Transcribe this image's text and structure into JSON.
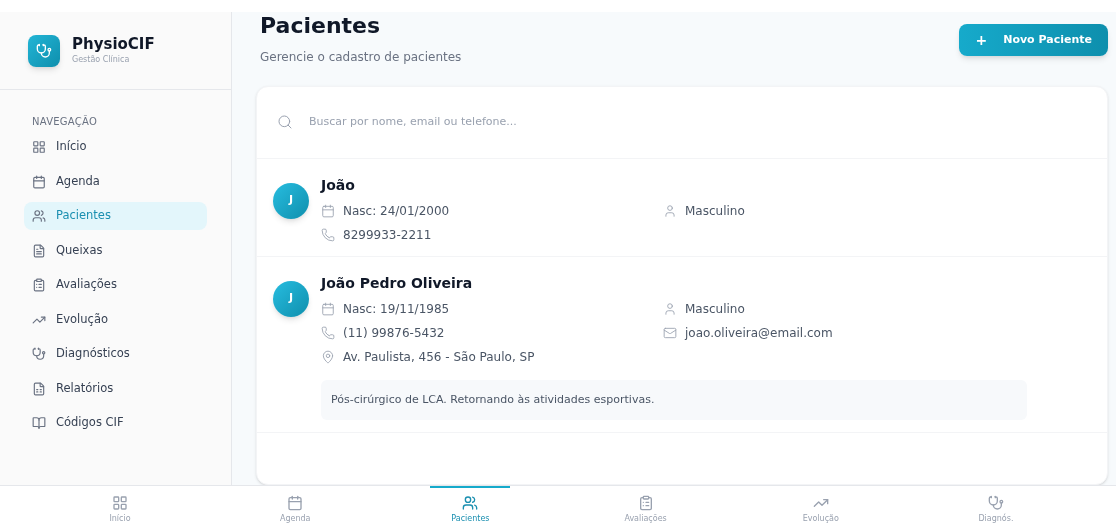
{
  "brand": {
    "name": "PhysioCIF",
    "tagline": "Gestão Clínica"
  },
  "sidebar": {
    "heading": "NAVEGAÇÃO",
    "items": [
      {
        "label": "Início",
        "kind": "grid",
        "selected": false
      },
      {
        "label": "Agenda",
        "kind": "calendar",
        "selected": false
      },
      {
        "label": "Pacientes",
        "kind": "users",
        "selected": true
      },
      {
        "label": "Queixas",
        "kind": "file",
        "selected": false
      },
      {
        "label": "Avaliações",
        "kind": "clipboard",
        "selected": false
      },
      {
        "label": "Evolução",
        "kind": "trend",
        "selected": false
      },
      {
        "label": "Diagnósticos",
        "kind": "stethoscope",
        "selected": false
      },
      {
        "label": "Relatórios",
        "kind": "report",
        "selected": false
      },
      {
        "label": "Códigos CIF",
        "kind": "book",
        "selected": false
      }
    ]
  },
  "header": {
    "title": "Pacientes",
    "subtitle": "Gerencie o cadastro de pacientes",
    "button": "Novo Paciente",
    "button_icon": "+"
  },
  "search": {
    "placeholder": "Buscar por nome, email ou telefone..."
  },
  "patients": [
    {
      "initial": "J",
      "name": "João",
      "birth": "Nasc: 24/01/2000",
      "gender": "Masculino",
      "phone": "8299933-2211"
    },
    {
      "initial": "J",
      "name": "João Pedro Oliveira",
      "birth": "Nasc: 19/11/1985",
      "gender": "Masculino",
      "phone": "(11) 99876-5432",
      "email": "joao.oliveira@email.com",
      "address": "Av. Paulista, 456 - São Paulo, SP",
      "note": "Pós-cirúrgico de LCA. Retornando às atividades esportivas."
    }
  ],
  "bottom_nav": [
    {
      "label": "Início",
      "kind": "grid",
      "selected": false
    },
    {
      "label": "Agenda",
      "kind": "calendar",
      "selected": false
    },
    {
      "label": "Pacientes",
      "kind": "users",
      "selected": true
    },
    {
      "label": "Avaliações",
      "kind": "clipboard",
      "selected": false
    },
    {
      "label": "Evolução",
      "kind": "trend",
      "selected": false
    },
    {
      "label": "Diagnós.",
      "kind": "stethoscope",
      "selected": false
    }
  ]
}
